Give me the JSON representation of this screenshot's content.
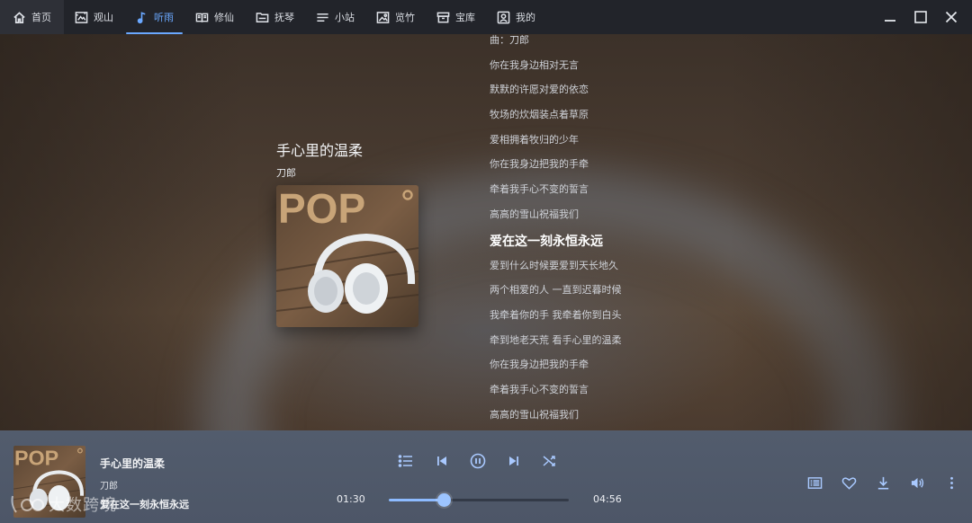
{
  "nav": {
    "items": [
      {
        "label": "首页",
        "icon": "home-icon"
      },
      {
        "label": "观山",
        "icon": "picture-frame-icon"
      },
      {
        "label": "听雨",
        "icon": "music-note-icon"
      },
      {
        "label": "修仙",
        "icon": "book-icon"
      },
      {
        "label": "抚琴",
        "icon": "folder-icon"
      },
      {
        "label": "小站",
        "icon": "menu-lines-icon"
      },
      {
        "label": "览竹",
        "icon": "image-icon"
      },
      {
        "label": "宝库",
        "icon": "toolbox-icon"
      },
      {
        "label": "我的",
        "icon": "user-card-icon"
      }
    ],
    "active_index": 2
  },
  "song": {
    "title": "手心里的温柔",
    "artist": "刀郎",
    "cover_text": "POP"
  },
  "lyrics": {
    "lines": [
      "曲：刀郎",
      "你在我身边相对无言",
      "默默的许愿对爱的依恋",
      "牧场的炊烟装点着草原",
      "爱相拥着牧归的少年",
      "你在我身边把我的手牵",
      "牵着我手心不变的誓言",
      "高高的雪山祝福我们",
      "爱在这一刻永恒永远",
      "爱到什么时候要爱到天长地久",
      "两个相爱的人 一直到迟暮时候",
      "我牵着你的手 我牵着你到白头",
      "牵到地老天荒 看手心里的温柔",
      "你在我身边把我的手牵",
      "牵着我手心不变的誓言",
      "高高的雪山祝福我们"
    ],
    "current_index": 8
  },
  "player": {
    "title": "手心里的温柔",
    "artist": "刀郎",
    "current_lyric": "爱在这一刻永恒永远",
    "time_current": "01:30",
    "time_total": "04:56",
    "progress": 0.304
  },
  "watermark": {
    "text": "大数跨境"
  },
  "colors": {
    "accent": "#6aa8ff",
    "topbar": "#22242a",
    "player": "#525c6d"
  }
}
